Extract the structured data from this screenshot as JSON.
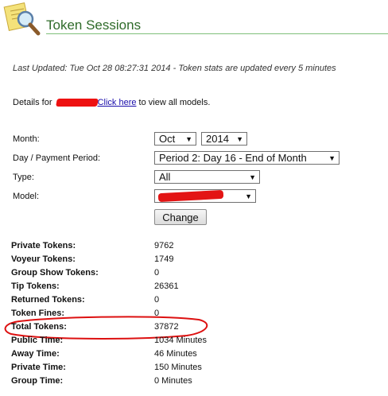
{
  "header": {
    "title": "Token Sessions",
    "logo_icon": "magnifier-on-paper-icon"
  },
  "last_updated": "Last Updated: Tue Oct 28 08:27:31 2014 - Token stats are updated every 5 minutes",
  "details": {
    "prefix": "Details for ",
    "link": "Click here",
    "suffix": " to view all models."
  },
  "form": {
    "month_label": "Month:",
    "month_value": "Oct",
    "year_value": "2014",
    "period_label": "Day / Payment Period:",
    "period_value": "Period 2: Day 16 - End of Month",
    "type_label": "Type:",
    "type_value": "All",
    "model_label": "Model:",
    "change_button": "Change"
  },
  "stats": [
    {
      "label": "Private Tokens:",
      "value": "9762"
    },
    {
      "label": "Voyeur Tokens:",
      "value": "1749"
    },
    {
      "label": "Group Show Tokens:",
      "value": "0"
    },
    {
      "label": "Tip Tokens:",
      "value": "26361"
    },
    {
      "label": "Returned Tokens:",
      "value": "0"
    },
    {
      "label": "Token Fines:",
      "value": "0"
    },
    {
      "label": "Total Tokens:",
      "value": "37872"
    },
    {
      "label": "Public Time:",
      "value": "1034 Minutes"
    },
    {
      "label": "Away Time:",
      "value": "46 Minutes"
    },
    {
      "label": "Private Time:",
      "value": "150 Minutes"
    },
    {
      "label": "Group Time:",
      "value": "0 Minutes"
    }
  ],
  "colors": {
    "title": "#2f6b2a",
    "redaction": "#e31414",
    "link": "#1a0dab"
  }
}
